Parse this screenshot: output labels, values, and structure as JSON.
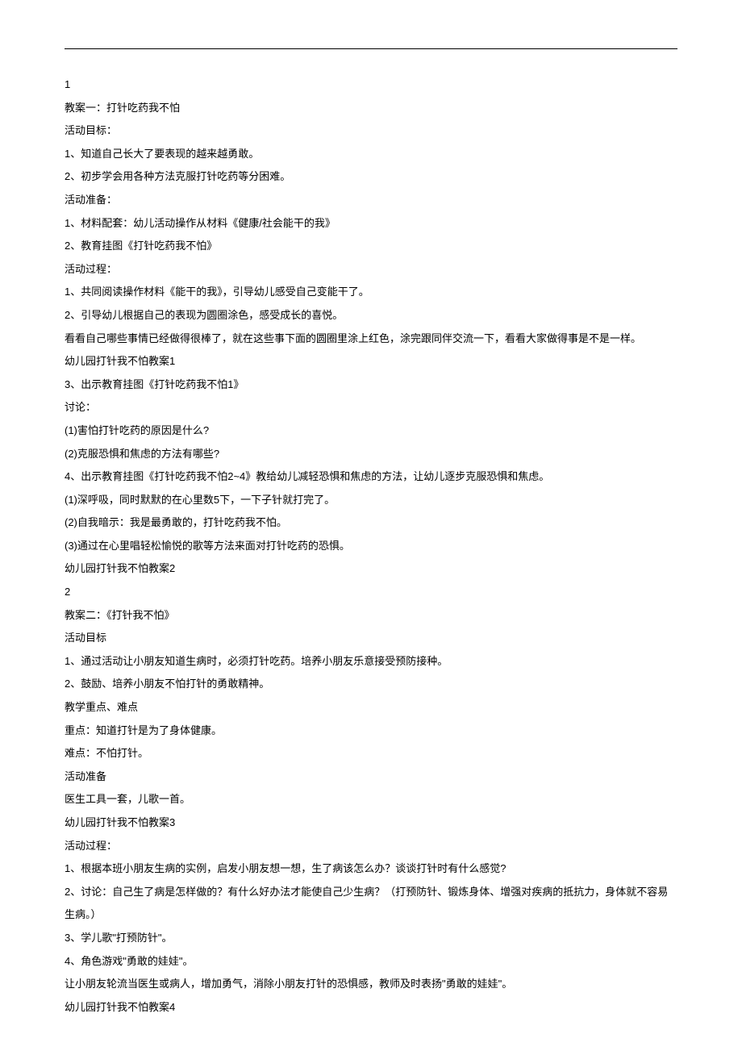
{
  "lines": [
    "1",
    "教案一：打针吃药我不怕",
    "活动目标：",
    "1、知道自己长大了要表现的越来越勇敢。",
    "2、初步学会用各种方法克服打针吃药等分困难。",
    "活动准备：",
    "1、材料配套：幼儿活动操作从材料《健康/社会能干的我》",
    "2、教育挂图《打针吃药我不怕》",
    "活动过程：",
    "1、共同阅读操作材料《能干的我》，引导幼儿感受自己变能干了。",
    "2、引导幼儿根据自己的表现为圆圈涂色，感受成长的喜悦。",
    "看看自己哪些事情已经做得很棒了，就在这些事下面的圆圈里涂上红色，涂完跟同伴交流一下，看看大家做得事是不是一样。",
    "幼儿园打针我不怕教案1",
    "3、出示教育挂图《打针吃药我不怕1》",
    "讨论：",
    "(1)害怕打针吃药的原因是什么?",
    "(2)克服恐惧和焦虑的方法有哪些?",
    "4、出示教育挂图《打针吃药我不怕2~4》教给幼儿减轻恐惧和焦虑的方法，让幼儿逐步克服恐惧和焦虑。",
    "(1)深呼吸，同时默默的在心里数5下，一下子针就打完了。",
    "(2)自我暗示：我是最勇敢的，打针吃药我不怕。",
    "(3)通过在心里唱轻松愉悦的歌等方法来面对打针吃药的恐惧。",
    "幼儿园打针我不怕教案2",
    "2",
    "教案二：《打针我不怕》",
    "活动目标",
    "1、通过活动让小朋友知道生病时，必须打针吃药。培养小朋友乐意接受预防接种。",
    "2、鼓励、培养小朋友不怕打针的勇敢精神。",
    "教学重点、难点",
    "重点：知道打针是为了身体健康。",
    "难点：不怕打针。",
    "活动准备",
    "医生工具一套，儿歌一首。",
    "幼儿园打针我不怕教案3",
    "活动过程：",
    "1、根据本班小朋友生病的实例，启发小朋友想一想，生了病该怎么办？谈谈打针时有什么感觉?",
    "2、讨论：自己生了病是怎样做的？有什么好办法才能使自己少生病？（打预防针、锻炼身体、增强对疾病的抵抗力，身体就不容易生病。）",
    "3、学儿歌\"打预防针\"。",
    "4、角色游戏\"勇敢的娃娃\"。",
    "让小朋友轮流当医生或病人，增加勇气，消除小朋友打针的恐惧感，教师及时表扬\"勇敢的娃娃\"。",
    "幼儿园打针我不怕教案4"
  ]
}
